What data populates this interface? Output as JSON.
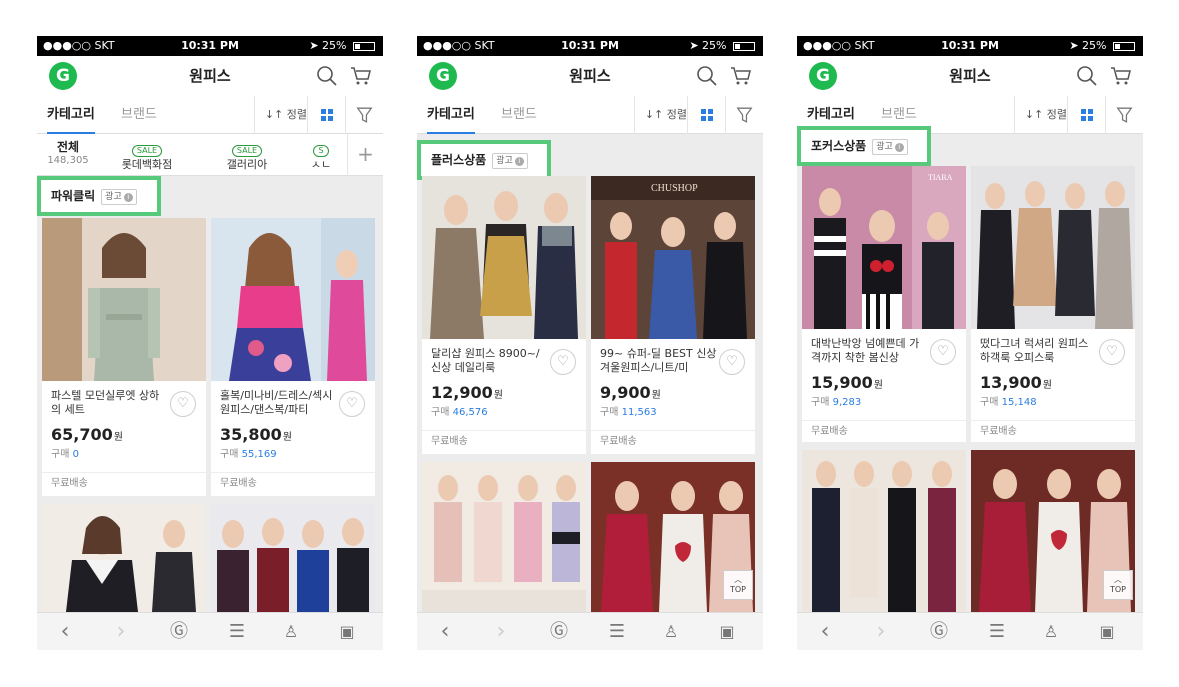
{
  "colors": {
    "brand_green": "#1fba4f",
    "accent_blue": "#2a7de1",
    "highlight_green": "#57c97b"
  },
  "phones": [
    {
      "status": {
        "carrier": "●●●○○ SKT",
        "time": "10:31 PM",
        "battery": "25%"
      },
      "header": {
        "logo": "G",
        "title": "원피스"
      },
      "tabs": {
        "category": "카테고리",
        "brand": "브랜드",
        "sort": "정렬"
      },
      "subnav": {
        "all_label": "전체",
        "all_count": "148,305",
        "stores": [
          {
            "badge": "SALE",
            "name": "롯데백화점"
          },
          {
            "badge": "SALE",
            "name": "갤러리아"
          },
          {
            "badge": "S",
            "name": "ㅅㄴ"
          }
        ],
        "plus": "+"
      },
      "ad_section": {
        "label": "파워클릭",
        "badge": "광고"
      },
      "products": [
        {
          "name": "파스텔 모던실루엣 상하의 세트",
          "price": "65,700",
          "won": "원",
          "buy_label": "구매",
          "buy_count": "0",
          "shipping": "무료배송"
        },
        {
          "name": "홀복/미나비/드레스/섹시원피스/댄스복/파티",
          "price": "35,800",
          "won": "원",
          "buy_label": "구매",
          "buy_count": "55,169",
          "shipping": "무료배송"
        }
      ],
      "top": ""
    },
    {
      "status": {
        "carrier": "●●●○○ SKT",
        "time": "10:31 PM",
        "battery": "25%"
      },
      "header": {
        "logo": "G",
        "title": "원피스"
      },
      "tabs": {
        "category": "카테고리",
        "brand": "브랜드",
        "sort": "정렬"
      },
      "ad_section": {
        "label": "플러스상품",
        "badge": "광고"
      },
      "photo_text": "CHUSHOP",
      "products": [
        {
          "name": "달리샵 원피스 8900~/신상 데일리룩",
          "price": "12,900",
          "won": "원",
          "buy_label": "구매",
          "buy_count": "46,576",
          "shipping": "무료배송"
        },
        {
          "name": "99~ 슈퍼-딜 BEST 신상 겨울원피스/니트/미",
          "price": "9,900",
          "won": "원",
          "buy_label": "구매",
          "buy_count": "11,563",
          "shipping": "무료배송"
        }
      ],
      "top": "TOP"
    },
    {
      "status": {
        "carrier": "●●●○○ SKT",
        "time": "10:31 PM",
        "battery": "25%"
      },
      "header": {
        "logo": "G",
        "title": "원피스"
      },
      "tabs": {
        "category": "카테고리",
        "brand": "브랜드",
        "sort": "정렬"
      },
      "ad_section": {
        "label": "포커스상품",
        "badge": "광고"
      },
      "photo_text": "TIARA",
      "products": [
        {
          "name": "대박난박앙 넘예쁜데 가격까지 착한 봄신상",
          "price": "15,900",
          "won": "원",
          "buy_label": "구매",
          "buy_count": "9,283",
          "shipping": "무료배송"
        },
        {
          "name": "떴다그녀 럭셔리 원피스 하객룩 오피스룩",
          "price": "13,900",
          "won": "원",
          "buy_label": "구매",
          "buy_count": "15,148",
          "shipping": "무료배송"
        }
      ],
      "top": "TOP"
    }
  ]
}
